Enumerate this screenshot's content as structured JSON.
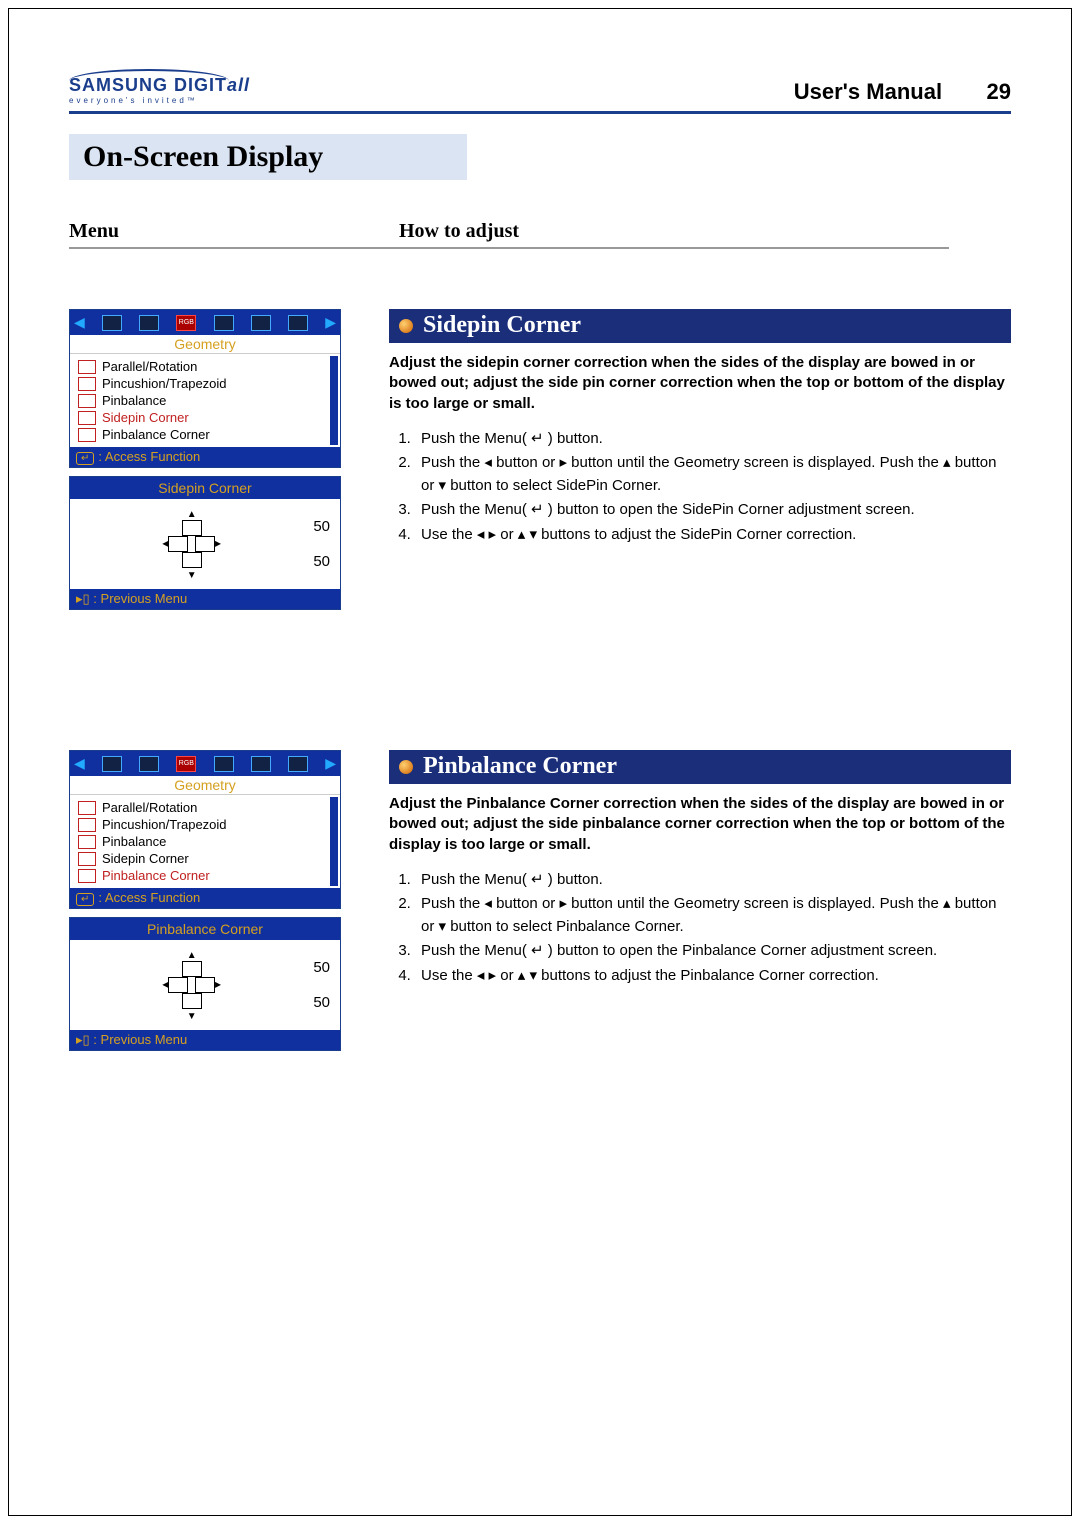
{
  "brand": {
    "name_main": "SAMSUNG DIGIT",
    "name_ital": "all",
    "tagline": "everyone's invited™"
  },
  "header": {
    "manual": "User's Manual",
    "page": "29"
  },
  "section_title": "On-Screen Display",
  "columns": {
    "menu": "Menu",
    "howto": "How to adjust"
  },
  "osd": {
    "category": "Geometry",
    "items": [
      "Parallel/Rotation",
      "Pincushion/Trapezoid",
      "Pinbalance",
      "Sidepin Corner",
      "Pinbalance Corner"
    ],
    "access": ": Access Function",
    "prev": ": Previous Menu"
  },
  "sections": [
    {
      "title": "Sidepin Corner",
      "selected_item": "Sidepin Corner",
      "adjust_title": "Sidepin Corner",
      "values": [
        "50",
        "50"
      ],
      "intro": "Adjust the sidepin corner correction when the sides of the display are bowed in or bowed out; adjust the side pin corner correction when the top or bottom of the display is too large or small.",
      "steps": [
        "Push the Menu( ↵ ) button.",
        "Push the ◂ button or ▸ button until the Geometry screen is displayed. Push the ▴ button or ▾ button to select SidePin Corner.",
        "Push the Menu( ↵ ) button to open the SidePin Corner adjustment screen.",
        "Use the ◂ ▸ or ▴ ▾ buttons to adjust the SidePin Corner correction."
      ]
    },
    {
      "title": "Pinbalance Corner",
      "selected_item": "Pinbalance Corner",
      "adjust_title": "Pinbalance Corner",
      "values": [
        "50",
        "50"
      ],
      "intro": "Adjust the Pinbalance Corner correction when the sides of the display are bowed in or bowed out; adjust the side pinbalance corner correction when the top or bottom of the display is too large or small.",
      "steps": [
        "Push the Menu( ↵ ) button.",
        "Push the ◂ button or ▸ button until the Geometry screen is displayed. Push the ▴ button or ▾ button to select Pinbalance Corner.",
        "Push the Menu( ↵ ) button to open the Pinbalance Corner adjustment screen.",
        "Use the ◂ ▸ or ▴ ▾ buttons to adjust the Pinbalance Corner correction."
      ]
    }
  ]
}
